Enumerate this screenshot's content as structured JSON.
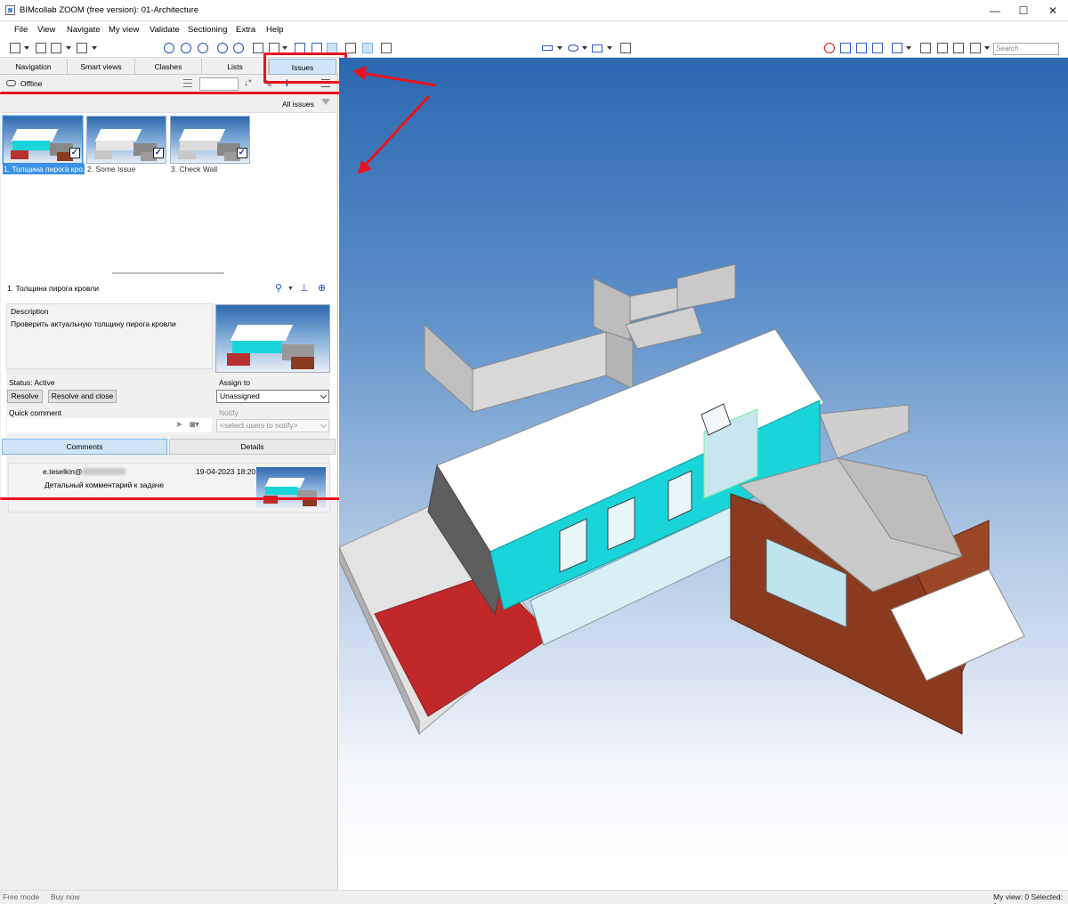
{
  "window": {
    "title": "BIMcollab ZOOM (free version): 01-Architecture",
    "controls": {
      "minimize": "—",
      "maximize": "☐",
      "close": "✕"
    }
  },
  "menu": [
    "File",
    "View",
    "Navigate",
    "My view",
    "Validate",
    "Sectioning",
    "Extra",
    "Help"
  ],
  "toolbar": {
    "search_placeholder": "Search"
  },
  "tabs": [
    "Navigation",
    "Smart views",
    "Clashes",
    "Lists",
    "Issues"
  ],
  "active_tab": "Issues",
  "connection": {
    "status": "Offline"
  },
  "issues_filter": {
    "label": "All issues"
  },
  "issues": [
    {
      "caption": "1. Толщина пирога кро...",
      "selected": true,
      "checked": true
    },
    {
      "caption": "2. Some Issue",
      "selected": false,
      "checked": true
    },
    {
      "caption": "3. Check Wall",
      "selected": false,
      "checked": true
    }
  ],
  "detail": {
    "title": "1. Толщина пирога кровли",
    "description_label": "Description",
    "description_text": "Проверить актуальную толщину пирога кровли",
    "status_text": "Status: Active",
    "resolve_button": "Resolve",
    "resolve_close_button": "Resolve and close",
    "assign_label": "Assign to",
    "assign_value": "Unassigned",
    "quick_comment_label": "Quick comment",
    "notify_label": "Notify",
    "notify_placeholder": "<select users to notify>"
  },
  "subtabs": [
    "Comments",
    "Details"
  ],
  "active_subtab": "Comments",
  "comments": [
    {
      "author": "e.teselkin@",
      "date": "19-04-2023 18:20",
      "text": "Детальный комментарий к задаче"
    }
  ],
  "statusbar": {
    "mode": "Free mode",
    "buy": "Buy now",
    "view_info": "My view: 0   Selected: 1"
  },
  "colors": {
    "annotation_red": "#e8141f",
    "selection_blue": "#3d92e8",
    "toolbar_blue": "#1f4fb8",
    "facade_cyan": "#19d5d9",
    "terrace_red": "#c0282a",
    "brick_brown": "#8a3b1f"
  }
}
